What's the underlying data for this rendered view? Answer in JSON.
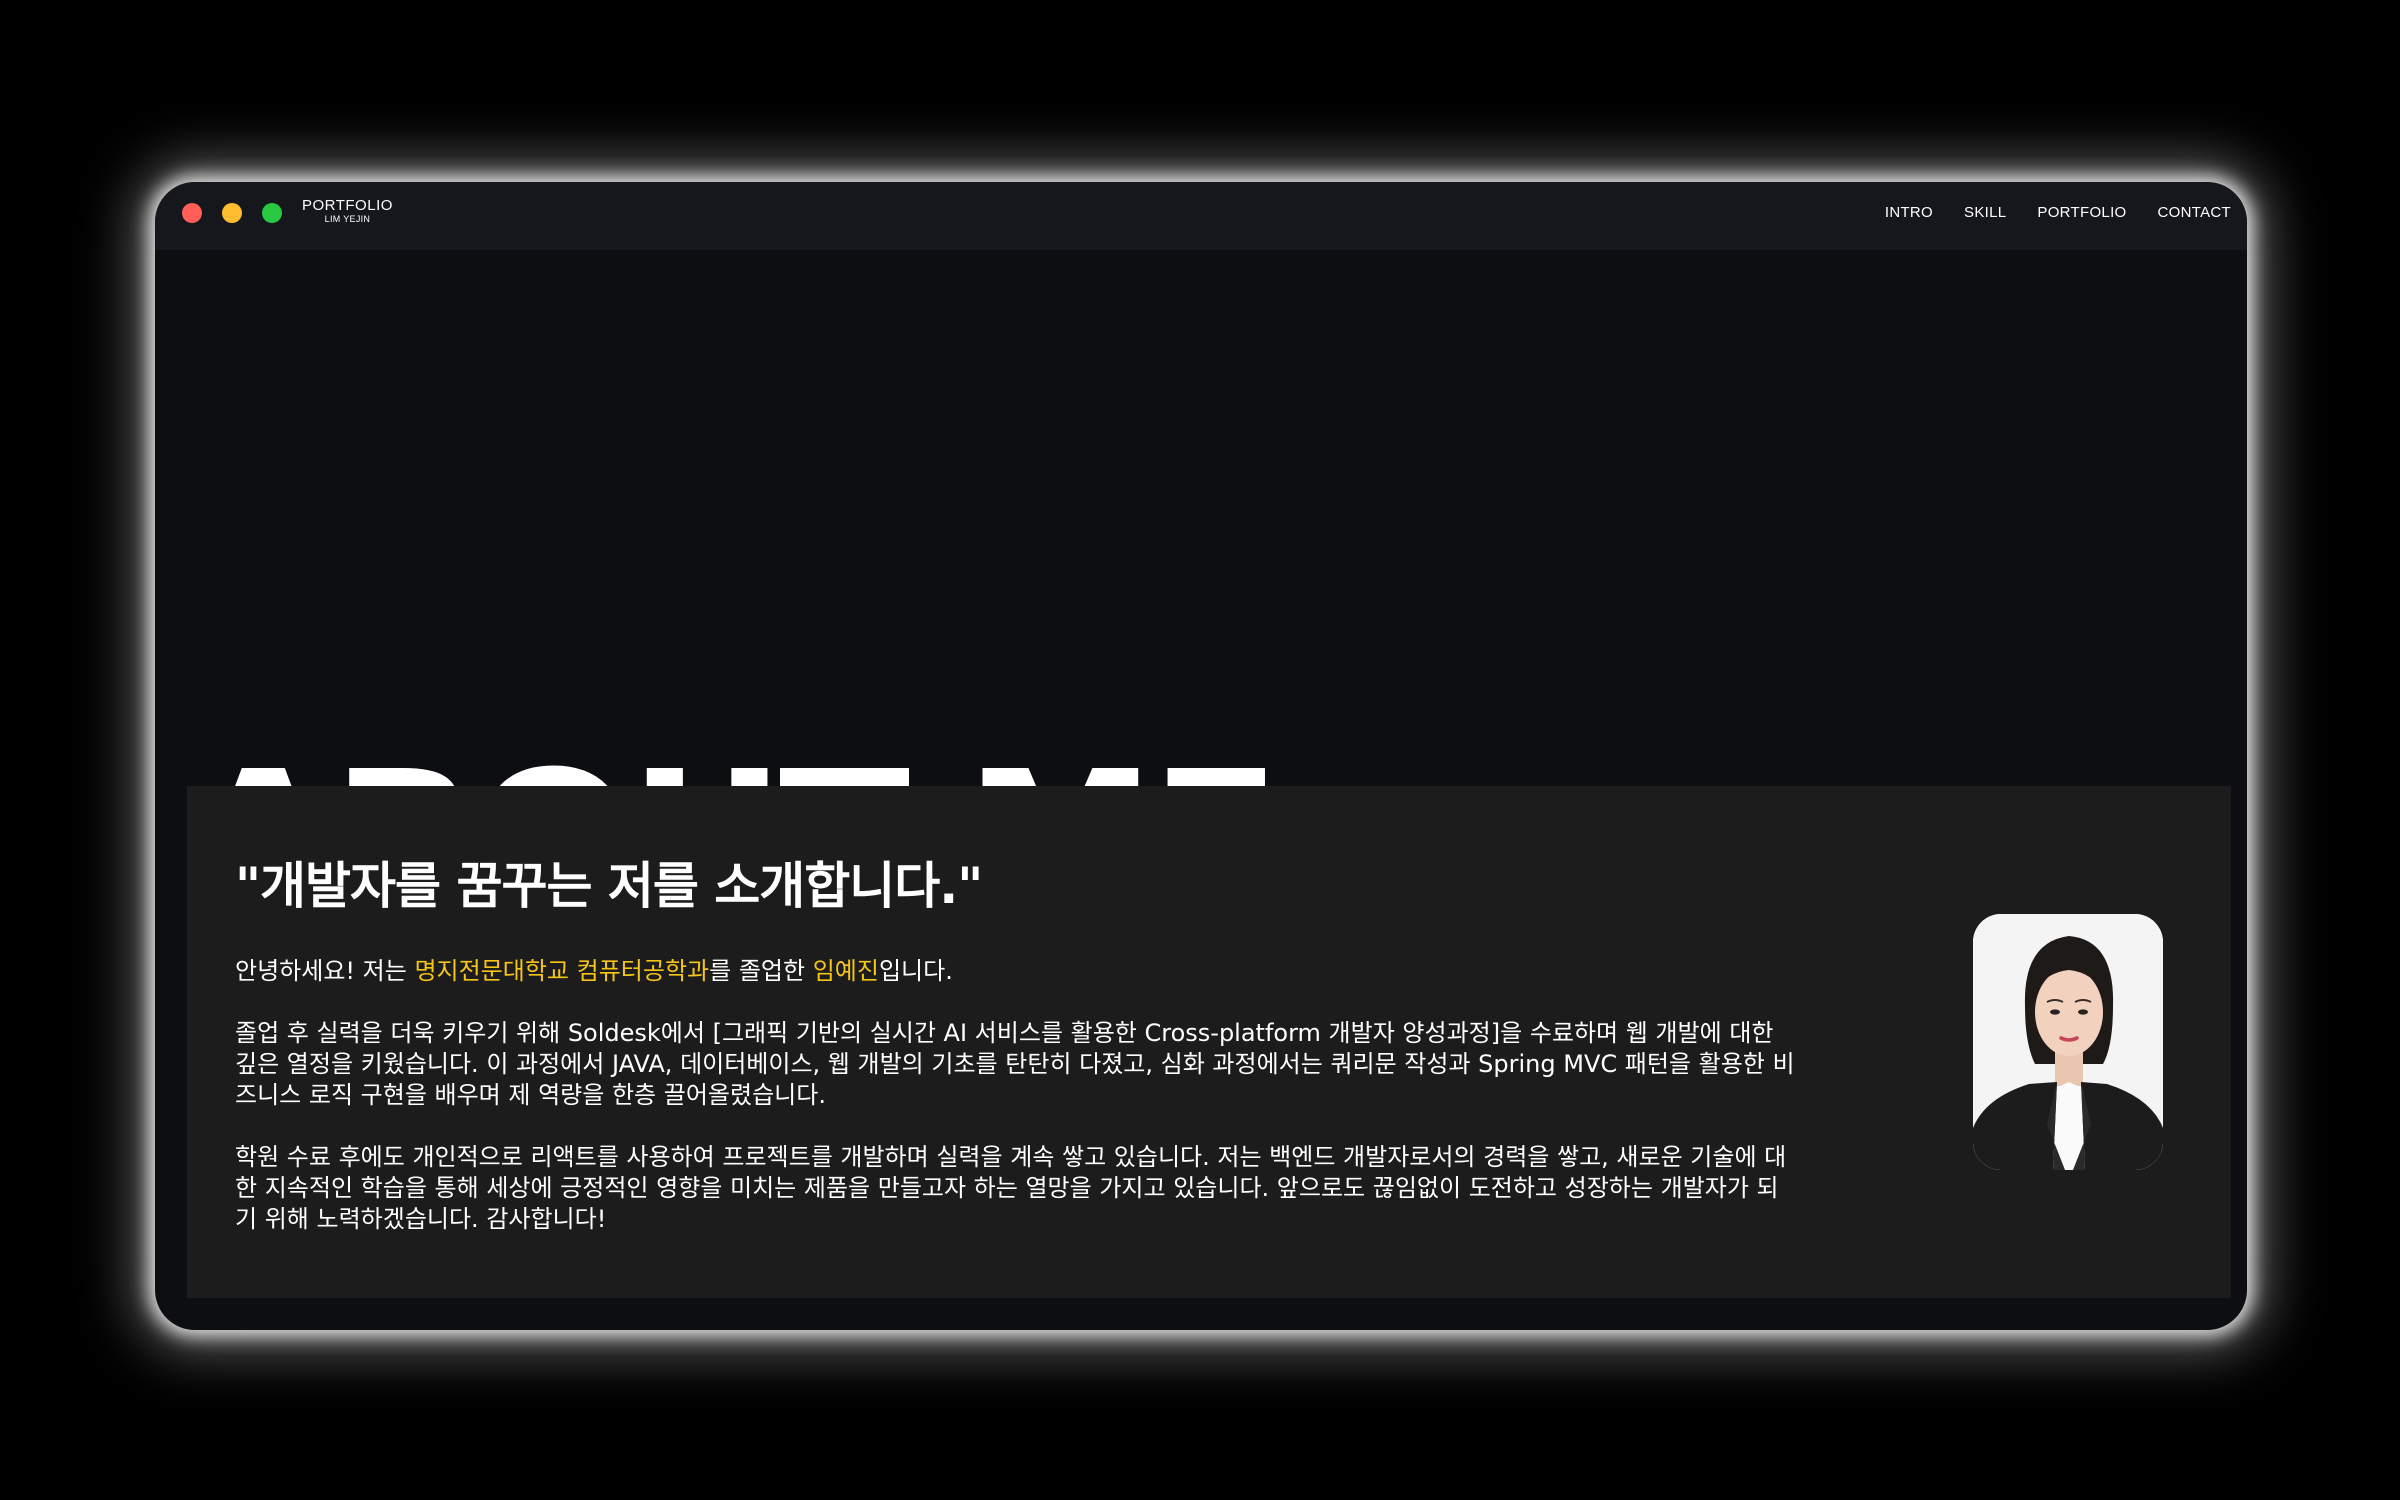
{
  "window": {
    "traffic_lights": [
      {
        "name": "close",
        "color": "#ff5f57"
      },
      {
        "name": "minimize",
        "color": "#febc2e"
      },
      {
        "name": "maximize",
        "color": "#28c840"
      }
    ]
  },
  "header": {
    "logo_title": "PORTFOLIO",
    "logo_subtitle": "LIM YEJIN",
    "nav": [
      "INTRO",
      "SKILL",
      "PORTFOLIO",
      "CONTACT"
    ]
  },
  "hero": {
    "title": "ABOUT ME"
  },
  "about": {
    "quote": "\"개발자를 꿈꾸는 저를 소개합니다.\"",
    "intro": {
      "prefix": "안녕하세요! 저는 ",
      "school": "명지전문대학교 컴퓨터공학과",
      "middle": "를 졸업한 ",
      "name": "임예진",
      "suffix": "입니다."
    },
    "paragraph2": "졸업 후 실력을 더욱 키우기 위해 Soldesk에서 [그래픽 기반의 실시간 AI 서비스를 활용한 Cross-platform 개발자 양성과정]을 수료하며 웹 개발에 대한 깊은 열정을 키웠습니다. 이 과정에서 JAVA, 데이터베이스, 웹 개발의 기초를 탄탄히 다졌고, 심화 과정에서는 쿼리문 작성과 Spring MVC 패턴을 활용한 비즈니스 로직 구현을 배우며 제 역량을 한층 끌어올렸습니다.",
    "paragraph3": "학원 수료 후에도 개인적으로 리액트를 사용하여 프로젝트를 개발하며 실력을 계속 쌓고 있습니다. 저는 백엔드 개발자로서의 경력을 쌓고, 새로운 기술에 대한 지속적인 학습을 통해 세상에 긍정적인 영향을 미치는 제품을 만들고자 하는 열망을 가지고 있습니다. 앞으로도 끊임없이 도전하고 성장하는 개발자가 되기 위해 노력하겠습니다. 감사합니다!",
    "highlight_color": "#f5c518"
  }
}
